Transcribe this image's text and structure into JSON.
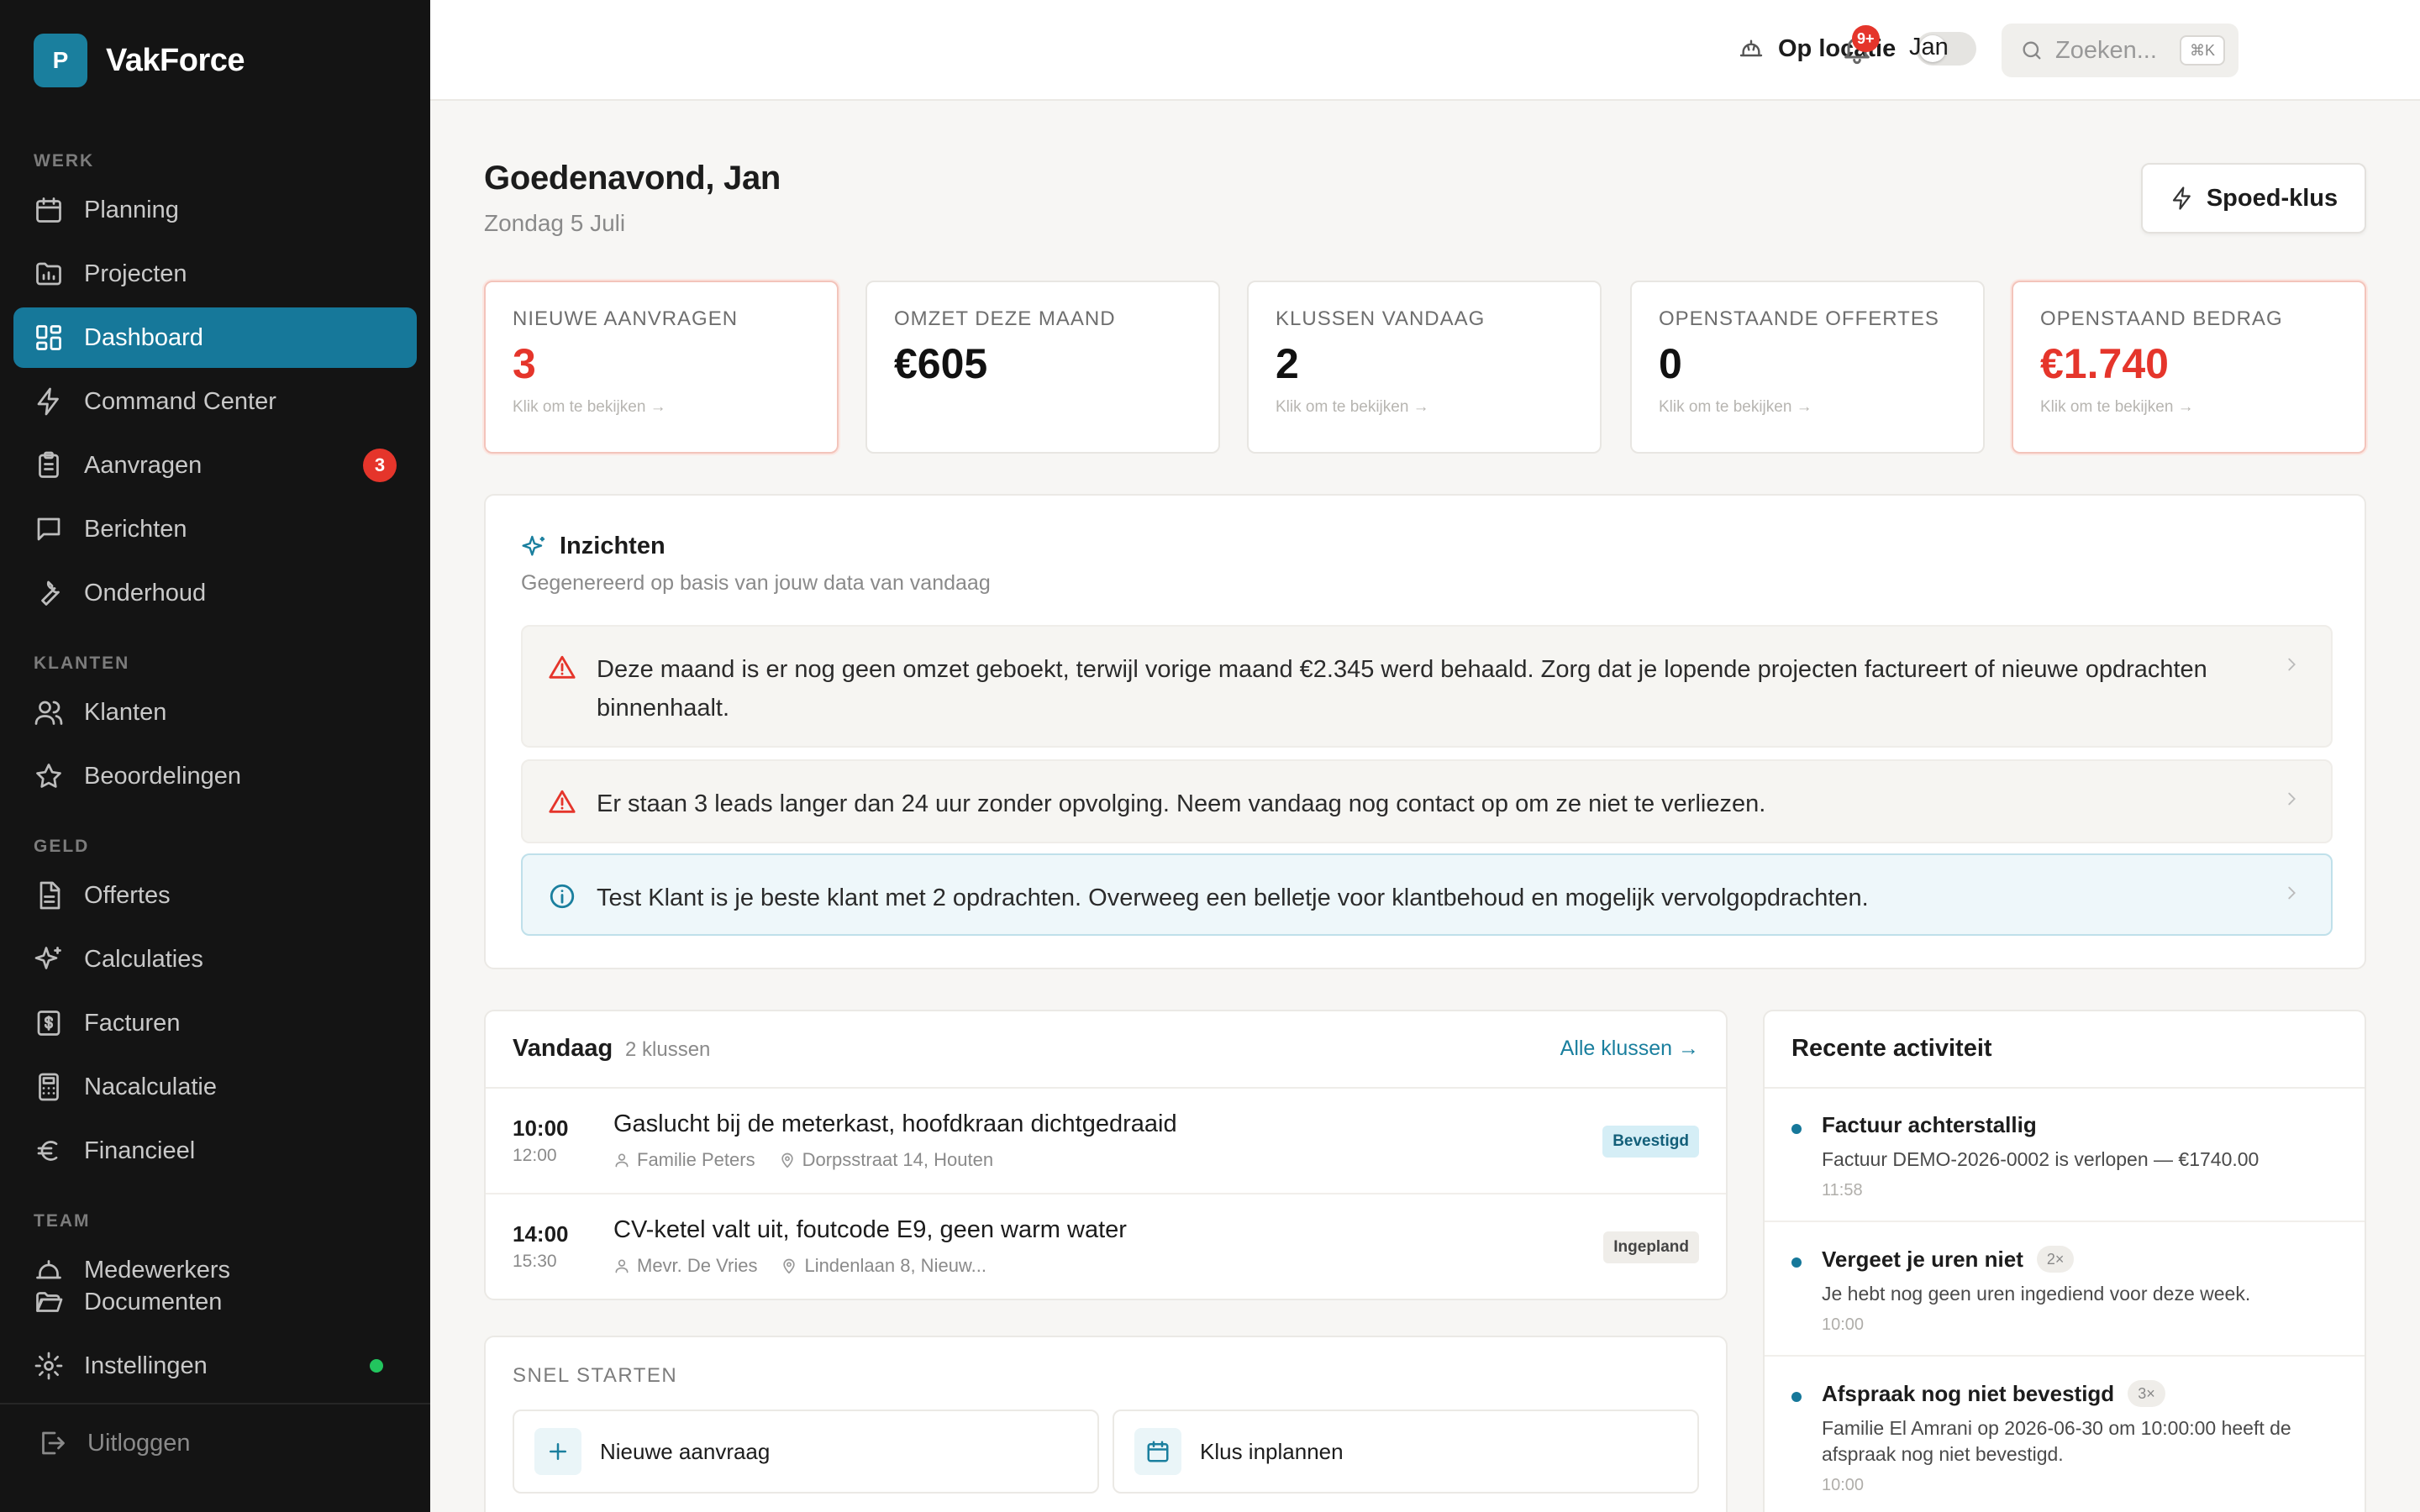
{
  "brand": {
    "logo_letter": "P",
    "name": "VakForce",
    "color": "#1a7f9e"
  },
  "sidebar": {
    "sections": [
      "WERK",
      "KLANTEN",
      "GELD",
      "TEAM"
    ],
    "items": [
      {
        "label": "Planning",
        "icon": "calendar-icon"
      },
      {
        "label": "Projecten",
        "icon": "folder-chart-icon"
      },
      {
        "label": "Dashboard",
        "icon": "grid-icon",
        "active": true
      },
      {
        "label": "Command Center",
        "icon": "bolt-icon"
      },
      {
        "label": "Aanvragen",
        "icon": "clipboard-icon",
        "badge": "3"
      },
      {
        "label": "Berichten",
        "icon": "message-icon"
      },
      {
        "label": "Onderhoud",
        "icon": "wrench-icon"
      },
      {
        "label": "Klanten",
        "icon": "users-icon"
      },
      {
        "label": "Beoordelingen",
        "icon": "star-icon"
      },
      {
        "label": "Offertes",
        "icon": "document-icon"
      },
      {
        "label": "Calculaties",
        "icon": "sparkles-icon"
      },
      {
        "label": "Facturen",
        "icon": "invoice-icon"
      },
      {
        "label": "Nacalculatie",
        "icon": "calculator-icon"
      },
      {
        "label": "Financieel",
        "icon": "euro-icon"
      },
      {
        "label": "Medewerkers",
        "icon": "helmet-icon"
      },
      {
        "label": "Documenten",
        "icon": "folder-open-icon"
      },
      {
        "label": "Instellingen",
        "icon": "gear-icon",
        "status_color": "#22c55e"
      }
    ],
    "logout_label": "Uitloggen"
  },
  "topbar": {
    "location_label": "Op locatie",
    "search_placeholder": "Zoeken...",
    "search_shortcut": "⌘K",
    "notification_badge": "9+",
    "user_name": "Jan"
  },
  "header": {
    "greeting": "Goedenavond, Jan",
    "date": "Zondag 5 Juli",
    "quick_action_label": "Spoed-klus"
  },
  "kpis": [
    {
      "label": "NIEUWE AANVRAGEN",
      "value": "3",
      "hint": "Klik om te bekijken →",
      "alert": true
    },
    {
      "label": "OMZET DEZE MAAND",
      "value": "€605",
      "hint": ""
    },
    {
      "label": "KLUSSEN VANDAAG",
      "value": "2",
      "hint": "Klik om te bekijken →"
    },
    {
      "label": "OPENSTAANDE OFFERTES",
      "value": "0",
      "hint": "Klik om te bekijken →"
    },
    {
      "label": "OPENSTAAND BEDRAG",
      "value": "€1.740",
      "hint": "Klik om te bekijken →",
      "alert": true
    }
  ],
  "insights": {
    "title": "Inzichten",
    "subtitle": "Gegenereerd op basis van jouw data van vandaag",
    "items": [
      {
        "type": "warning",
        "text": "Deze maand is er nog geen omzet geboekt, terwijl vorige maand €2.345 werd behaald. Zorg dat je lopende projecten factureert of nieuwe opdrachten binnenhaalt."
      },
      {
        "type": "warning",
        "text": "Er staan 3 leads langer dan 24 uur zonder opvolging. Neem vandaag nog contact op om ze niet te verliezen."
      },
      {
        "type": "info",
        "text": "Test Klant is je beste klant met 2 opdrachten. Overweeg een belletje voor klantbehoud en mogelijk vervolgopdrachten."
      }
    ]
  },
  "today": {
    "title": "Vandaag",
    "count": "2 klussen",
    "link": "Alle klussen →",
    "jobs": [
      {
        "start": "10:00",
        "end": "12:00",
        "title": "Gaslucht bij de meterkast, hoofdkraan dichtgedraaid",
        "client": "Familie Peters",
        "address": "Dorpsstraat 14, Houten",
        "status": "Bevestigd"
      },
      {
        "start": "14:00",
        "end": "15:30",
        "title": "CV-ketel valt uit, foutcode E9, geen warm water",
        "client": "Mevr. De Vries",
        "address": "Lindenlaan 8, Nieuw...",
        "status": "Ingepland"
      }
    ]
  },
  "quick_start": {
    "label": "SNEL STARTEN",
    "actions": [
      {
        "label": "Nieuwe aanvraag",
        "icon": "plus-icon"
      },
      {
        "label": "Klus inplannen",
        "icon": "calendar-icon"
      }
    ]
  },
  "activity": {
    "title": "Recente activiteit",
    "items": [
      {
        "title": "Factuur achterstallig",
        "multiplier": "",
        "desc": "Factuur DEMO-2026-0002 is verlopen — €1740.00",
        "time": "11:58"
      },
      {
        "title": "Vergeet je uren niet",
        "multiplier": "2×",
        "desc": "Je hebt nog geen uren ingediend voor deze week.",
        "time": "10:00"
      },
      {
        "title": "Afspraak nog niet bevestigd",
        "multiplier": "3×",
        "desc": "Familie El Amrani op 2026-06-30 om 10:00:00 heeft de afspraak nog niet bevestigd.",
        "time": "10:00"
      }
    ]
  },
  "colors": {
    "accent": "#16789a",
    "danger": "#e5352b",
    "success": "#22c55e",
    "sidebar_bg": "#141414"
  }
}
